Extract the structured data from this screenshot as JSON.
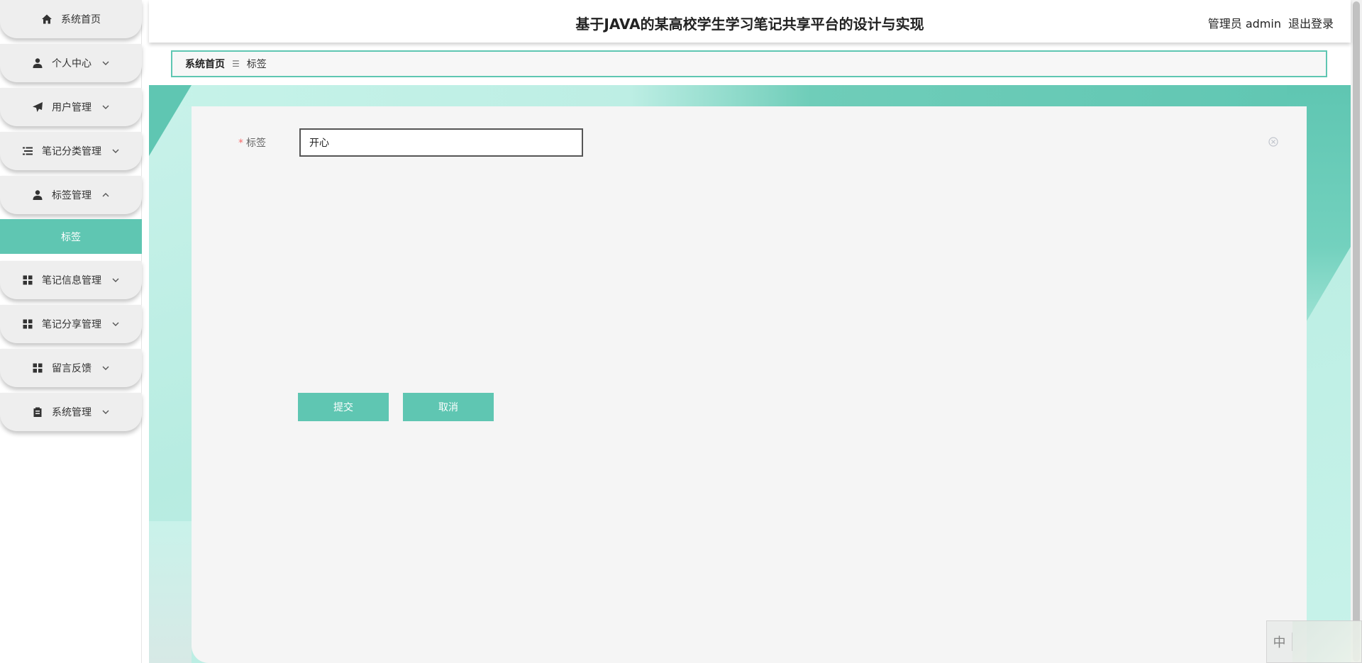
{
  "header": {
    "title": "基于JAVA的某高校学生学习笔记共享平台的设计与实现",
    "user_label": "管理员 admin",
    "logout_label": "退出登录"
  },
  "sidebar": {
    "items": [
      {
        "label": "系统首页",
        "icon": "home-icon"
      },
      {
        "label": "个人中心",
        "icon": "user-icon"
      },
      {
        "label": "用户管理",
        "icon": "send-icon"
      },
      {
        "label": "笔记分类管理",
        "icon": "list-icon"
      },
      {
        "label": "标签管理",
        "icon": "user-icon"
      },
      {
        "label": "笔记信息管理",
        "icon": "grid-icon"
      },
      {
        "label": "笔记分享管理",
        "icon": "grid-icon"
      },
      {
        "label": "留言反馈",
        "icon": "grid-icon"
      },
      {
        "label": "系统管理",
        "icon": "clipboard-icon"
      }
    ],
    "active_sub_item": "标签"
  },
  "breadcrumb": {
    "home": "系统首页",
    "separator": "☰",
    "current": "标签"
  },
  "form": {
    "tag_label": "标签",
    "required_mark": "*",
    "tag_value": "开心",
    "submit_label": "提交",
    "cancel_label": "取消"
  },
  "ime": {
    "lang": "中"
  },
  "colors": {
    "accent": "#5fc6b2",
    "panel_bg": "#f5f5f5",
    "required": "#f56c6c"
  }
}
